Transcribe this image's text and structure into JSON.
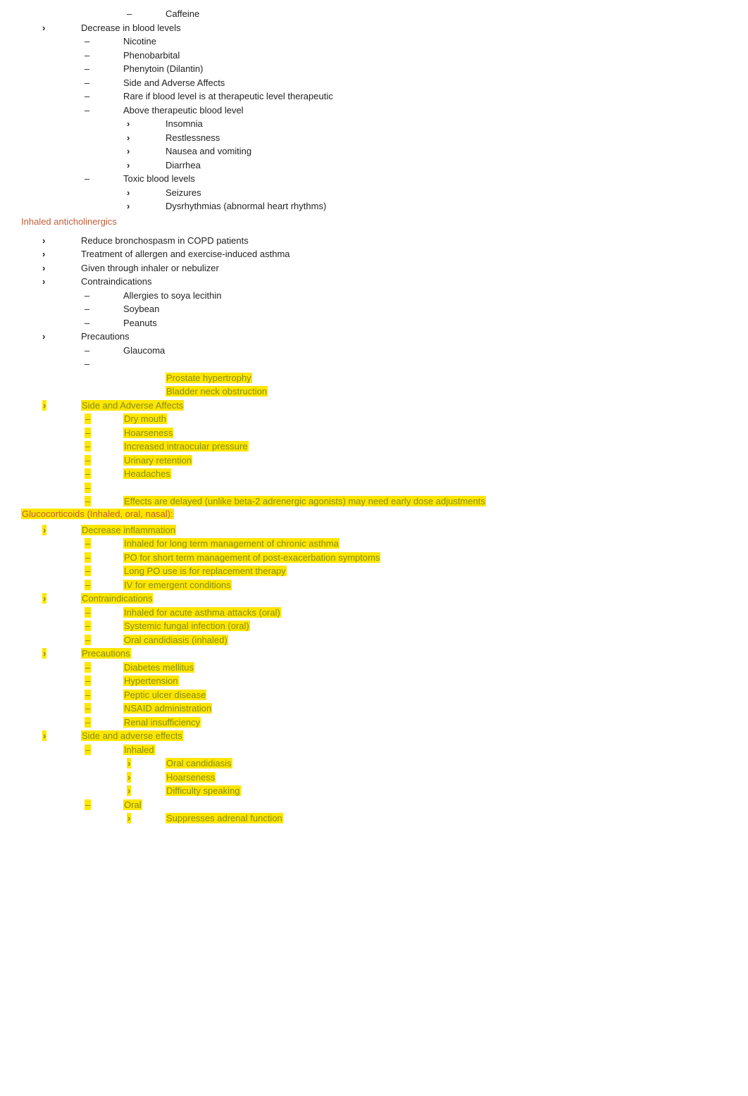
{
  "section1": {
    "items": [
      {
        "level": 2,
        "marker": "dash",
        "text": "Caffeine"
      },
      {
        "level": 0,
        "marker": "chev",
        "text": "Decrease in blood levels"
      },
      {
        "level": 1,
        "marker": "dash",
        "text": "Nicotine"
      },
      {
        "level": 1,
        "marker": "dash",
        "text": "Phenobarbital"
      },
      {
        "level": 1,
        "marker": "dash",
        "text": "Phenytoin (Dilantin)"
      },
      {
        "level": 1,
        "marker": "dash",
        "text": "Side and Adverse Affects"
      },
      {
        "level": 1,
        "marker": "dash",
        "text": "Rare if blood level is at therapeutic level therapeutic"
      },
      {
        "level": 1,
        "marker": "dash",
        "text": "Above therapeutic blood level"
      },
      {
        "level": 2,
        "marker": "chev",
        "text": "Insomnia"
      },
      {
        "level": 2,
        "marker": "chev",
        "text": "Restlessness"
      },
      {
        "level": 2,
        "marker": "chev",
        "text": "Nausea and vomiting"
      },
      {
        "level": 2,
        "marker": "chev",
        "text": "Diarrhea"
      },
      {
        "level": 1,
        "marker": "dash",
        "text": "Toxic blood levels"
      },
      {
        "level": 2,
        "marker": "chev",
        "text": "Seizures"
      },
      {
        "level": 2,
        "marker": "chev",
        "text": "Dysrhythmias (abnormal heart rhythms)"
      }
    ]
  },
  "heading_anticholinergics": "Inhaled anticholinergics",
  "section2": {
    "items": [
      {
        "level": 0,
        "marker": "chev",
        "text": "Reduce bronchospasm in COPD patients"
      },
      {
        "level": 0,
        "marker": "chev",
        "text": "Treatment of allergen and exercise-induced asthma"
      },
      {
        "level": 0,
        "marker": "chev",
        "text": "Given through inhaler or nebulizer"
      },
      {
        "level": 0,
        "marker": "chev",
        "text": "Contraindications"
      },
      {
        "level": 1,
        "marker": "dash",
        "text": "Allergies to soya lecithin"
      },
      {
        "level": 1,
        "marker": "dash",
        "text": "Soybean"
      },
      {
        "level": 1,
        "marker": "dash",
        "text": "Peanuts"
      },
      {
        "level": 0,
        "marker": "chev",
        "text": "Precautions"
      },
      {
        "level": 1,
        "marker": "dash",
        "text": "Glaucoma"
      },
      {
        "level": 1,
        "marker": "dash",
        "text": ""
      }
    ]
  },
  "hl_section1": {
    "items": [
      {
        "level": 2,
        "marker": "none",
        "text": "Prostate hypertrophy"
      },
      {
        "level": 2,
        "marker": "none",
        "text": "Bladder neck obstruction"
      },
      {
        "level": 0,
        "marker": "chev",
        "text": "Side and Adverse Affects"
      },
      {
        "level": 1,
        "marker": "dash",
        "text": "Dry mouth"
      },
      {
        "level": 1,
        "marker": "dash",
        "text": "Hoarseness"
      },
      {
        "level": 1,
        "marker": "dash",
        "text": "Increased intraocular pressure"
      },
      {
        "level": 1,
        "marker": "dash",
        "text": "Urinary retention"
      },
      {
        "level": 1,
        "marker": "dash",
        "text": "Headaches"
      },
      {
        "level": 1,
        "marker": "dash",
        "text": ""
      },
      {
        "level": 1,
        "marker": "dash",
        "text": "Effects are delayed (unlike beta-2 adrenergic agonists) may need early dose adjustments"
      }
    ]
  },
  "heading_glucocorticoids": "Glucocorticoids (Inhaled, oral, nasal):",
  "hl_section2": {
    "items": [
      {
        "level": 0,
        "marker": "chev",
        "text": "Decrease inflammation"
      },
      {
        "level": 1,
        "marker": "dash",
        "text": "Inhaled for long term management of chronic asthma"
      },
      {
        "level": 1,
        "marker": "dash",
        "text": "PO for short term management of post-exacerbation symptoms"
      },
      {
        "level": 1,
        "marker": "dash",
        "text": "Long PO use is for replacement therapy"
      },
      {
        "level": 1,
        "marker": "dash",
        "text": "IV for emergent conditions"
      },
      {
        "level": 0,
        "marker": "chev",
        "text": "Contraindications"
      },
      {
        "level": 1,
        "marker": "dash",
        "text": "Inhaled for acute asthma attacks (oral)"
      },
      {
        "level": 1,
        "marker": "dash",
        "text": "Systemic fungal infection (oral)"
      },
      {
        "level": 1,
        "marker": "dash",
        "text": "Oral candidiasis (inhaled)"
      },
      {
        "level": 0,
        "marker": "chev",
        "text": "Precautions"
      },
      {
        "level": 1,
        "marker": "dash",
        "text": "Diabetes mellitus"
      },
      {
        "level": 1,
        "marker": "dash",
        "text": "Hypertension"
      },
      {
        "level": 1,
        "marker": "dash",
        "text": "Peptic ulcer disease"
      },
      {
        "level": 1,
        "marker": "dash",
        "text": "NSAID administration"
      },
      {
        "level": 1,
        "marker": "dash",
        "text": "Renal insufficiency"
      },
      {
        "level": 0,
        "marker": "chev",
        "text": "Side and adverse effects"
      },
      {
        "level": 1,
        "marker": "dash",
        "text": "Inhaled"
      },
      {
        "level": 2,
        "marker": "chev",
        "text": "Oral candidiasis"
      },
      {
        "level": 2,
        "marker": "chev",
        "text": "Hoarseness"
      },
      {
        "level": 2,
        "marker": "chev",
        "text": "Difficulty speaking"
      },
      {
        "level": 1,
        "marker": "dash",
        "text": "Oral"
      },
      {
        "level": 2,
        "marker": "chev",
        "text": "Suppresses adrenal function"
      }
    ]
  }
}
